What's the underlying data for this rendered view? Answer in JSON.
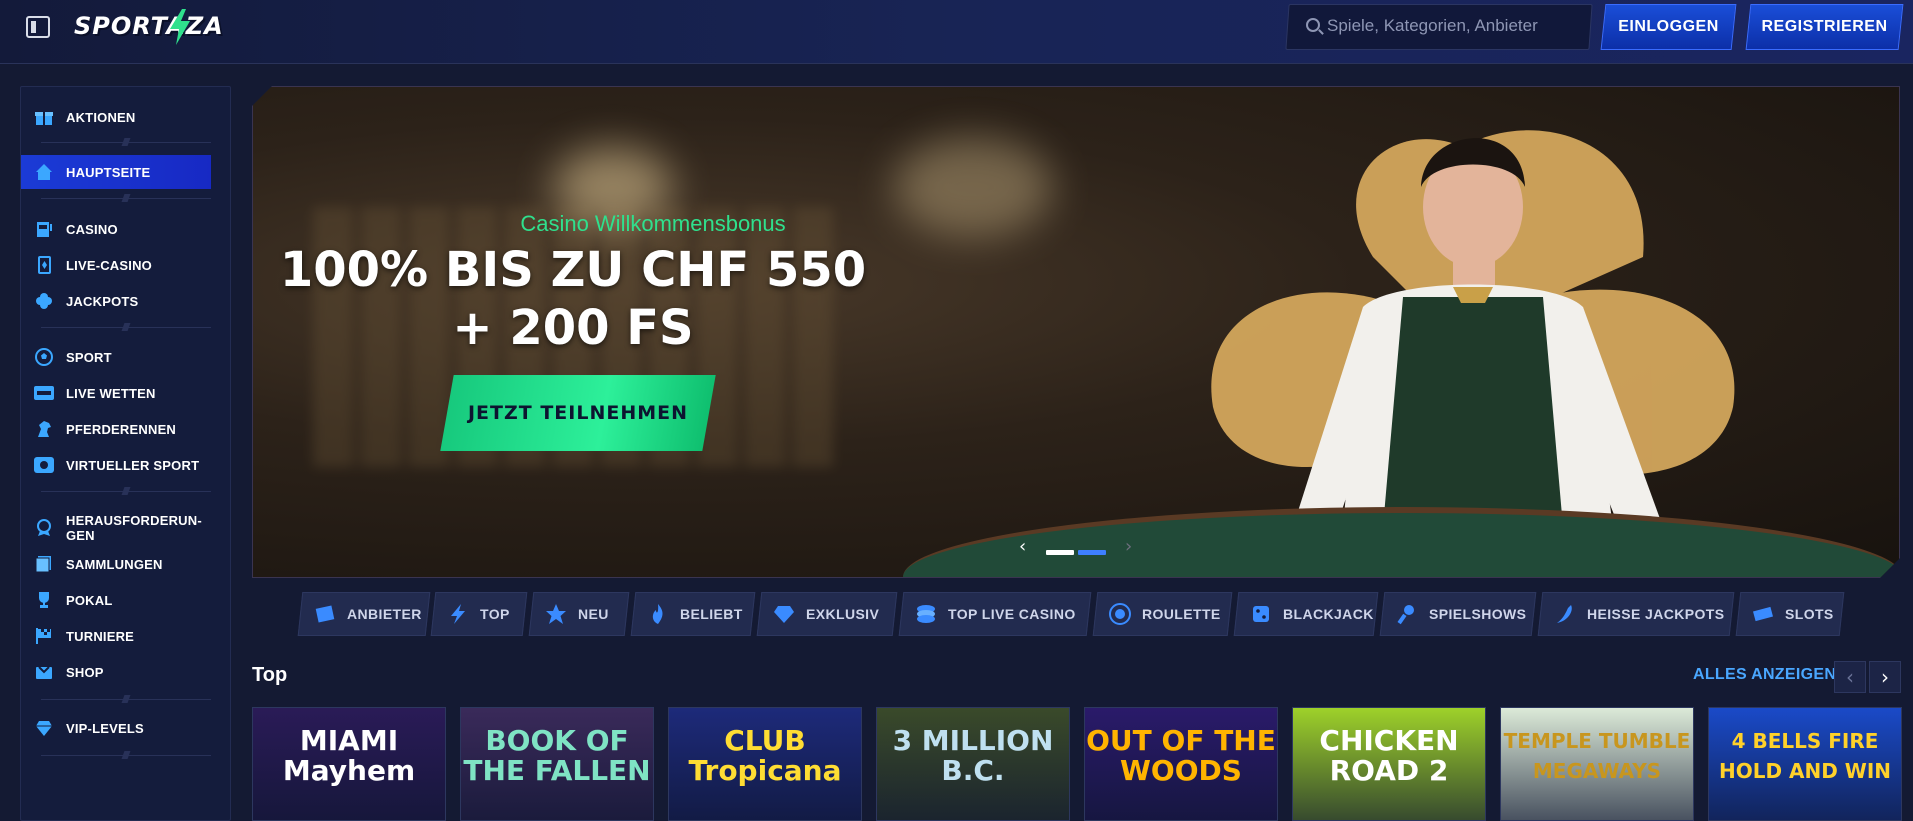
{
  "header": {
    "logo_text": "SPORTAZA",
    "search_placeholder": "Spiele, Kategorien, Anbieter",
    "login_label": "EINLOGGEN",
    "register_label": "REGISTRIEREN"
  },
  "sidebar": {
    "items": [
      {
        "label": "AKTIONEN",
        "icon": "gift-icon"
      },
      {
        "label": "HAUPTSEITE",
        "icon": "home-icon",
        "active": true
      },
      {
        "label": "CASINO",
        "icon": "slot-machine-icon"
      },
      {
        "label": "LIVE-CASINO",
        "icon": "card-icon"
      },
      {
        "label": "JACKPOTS",
        "icon": "clover-icon"
      },
      {
        "label": "SPORT",
        "icon": "soccer-ball-icon"
      },
      {
        "label": "LIVE WETTEN",
        "icon": "live-badge-icon"
      },
      {
        "label": "PFERDERENNEN",
        "icon": "horse-icon"
      },
      {
        "label": "VIRTUELLER SPORT",
        "icon": "virtual-sport-icon"
      },
      {
        "label": "HERAUSFORDERUN-GEN",
        "icon": "challenge-icon"
      },
      {
        "label": "SAMMLUNGEN",
        "icon": "collection-icon"
      },
      {
        "label": "POKAL",
        "icon": "trophy-icon"
      },
      {
        "label": "TURNIERE",
        "icon": "flag-icon"
      },
      {
        "label": "SHOP",
        "icon": "shop-icon"
      },
      {
        "label": "VIP-LEVELS",
        "icon": "diamond-icon"
      }
    ]
  },
  "hero": {
    "subtitle": "Casino Willkommensbonus",
    "title": "100% BIS ZU CHF 550 + 200 FS",
    "cta_label": "JETZT TEILNEHMEN",
    "prev_arrow": "‹",
    "next_arrow": "›"
  },
  "categories": [
    {
      "label": "ANBIETER",
      "icon": "provider-icon"
    },
    {
      "label": "TOP",
      "icon": "lightning-icon"
    },
    {
      "label": "NEU",
      "icon": "star-icon"
    },
    {
      "label": "BELIEBT",
      "icon": "flame-icon"
    },
    {
      "label": "EXKLUSIV",
      "icon": "diamond-icon"
    },
    {
      "label": "TOP LIVE CASINO",
      "icon": "chips-icon"
    },
    {
      "label": "ROULETTE",
      "icon": "roulette-icon"
    },
    {
      "label": "BLACKJACK",
      "icon": "dice-icon"
    },
    {
      "label": "SPIELSHOWS",
      "icon": "microphone-icon"
    },
    {
      "label": "HEISSE JACKPOTS",
      "icon": "chili-icon"
    },
    {
      "label": "SLOTS",
      "icon": "slots-icon"
    }
  ],
  "section": {
    "title": "Top",
    "see_all_label": "ALLES ANZEIGEN",
    "prev": "‹",
    "next": "›"
  },
  "games": [
    {
      "name": "MIAMI Mayhem",
      "bg": "#2a1b57",
      "color": "#ffffff"
    },
    {
      "name": "BOOK OF THE FALLEN",
      "bg": "#3a2a5a",
      "color": "#7fe3c4"
    },
    {
      "name": "CLUB Tropicana",
      "bg": "#1d2a7a",
      "color": "#ffdd33"
    },
    {
      "name": "3 MILLION B.C.",
      "bg": "#3a4a2a",
      "color": "#bfe0f0"
    },
    {
      "name": "OUT OF THE WOODS",
      "bg": "#2a1a6a",
      "color": "#ffb400"
    },
    {
      "name": "CHICKEN ROAD 2",
      "bg": "#9ed12a",
      "color": "#ffffff"
    },
    {
      "name": "TEMPLE TUMBLE MEGAWAYS",
      "bg": "#dcead8",
      "color": "#c8961e"
    },
    {
      "name": "4 BELLS FIRE HOLD AND WIN",
      "bg": "#1a4ac8",
      "color": "#ffd12a"
    }
  ]
}
